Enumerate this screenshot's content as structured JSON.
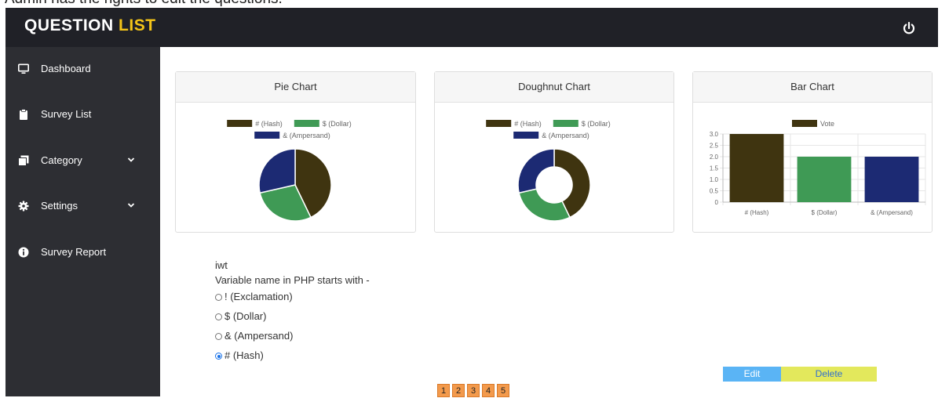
{
  "caption": "Admin has the rights to edit the questions.",
  "app": {
    "title_main": "QUESTION",
    "title_accent": "LIST",
    "power_icon": "power-icon"
  },
  "sidebar": {
    "items": [
      {
        "label": "Dashboard",
        "icon": "monitor-icon"
      },
      {
        "label": "Survey List",
        "icon": "clipboard-icon"
      },
      {
        "label": "Category",
        "icon": "copy-icon",
        "expandable": true
      },
      {
        "label": "Settings",
        "icon": "gear-icon",
        "expandable": true
      },
      {
        "label": "Survey Report",
        "icon": "info-icon"
      }
    ]
  },
  "colors": {
    "hash": "#3f3410",
    "dollar": "#3f9a55",
    "ampersand": "#1c2a73",
    "accent": "#f5c518"
  },
  "cards": {
    "pie_title": "Pie Chart",
    "doughnut_title": "Doughnut Chart",
    "bar_title": "Bar Chart"
  },
  "chart_data": [
    {
      "type": "pie",
      "title": "Pie Chart",
      "categories": [
        "# (Hash)",
        "$ (Dollar)",
        "& (Ampersand)"
      ],
      "values": [
        3,
        2,
        2
      ],
      "colors": [
        "#3f3410",
        "#3f9a55",
        "#1c2a73"
      ],
      "legend": "top"
    },
    {
      "type": "pie",
      "title": "Doughnut Chart",
      "categories": [
        "# (Hash)",
        "$ (Dollar)",
        "& (Ampersand)"
      ],
      "values": [
        3,
        2,
        2
      ],
      "colors": [
        "#3f3410",
        "#3f9a55",
        "#1c2a73"
      ],
      "legend": "top"
    },
    {
      "type": "bar",
      "title": "Bar Chart",
      "categories": [
        "# (Hash)",
        "$ (Dollar)",
        "& (Ampersand)"
      ],
      "series": [
        {
          "name": "Vote",
          "values": [
            3,
            2,
            2
          ]
        }
      ],
      "colors": [
        "#3f3410",
        "#3f9a55",
        "#1c2a73"
      ],
      "yticks": [
        "0",
        "0.5",
        "1.0",
        "1.5",
        "2.0",
        "2.5",
        "3.0"
      ],
      "ylim": [
        0,
        3
      ],
      "grid": true,
      "legend": "top"
    }
  ],
  "question": {
    "survey": "iwt",
    "text": "Variable name in PHP starts with -",
    "options": [
      {
        "label": "! (Exclamation)",
        "checked": false
      },
      {
        "label": "$ (Dollar)",
        "checked": false
      },
      {
        "label": "& (Ampersand)",
        "checked": false
      },
      {
        "label": "# (Hash)",
        "checked": true
      }
    ]
  },
  "actions": {
    "edit_label": "Edit",
    "delete_label": "Delete"
  },
  "pagination": [
    "1",
    "2",
    "3",
    "4",
    "5"
  ]
}
